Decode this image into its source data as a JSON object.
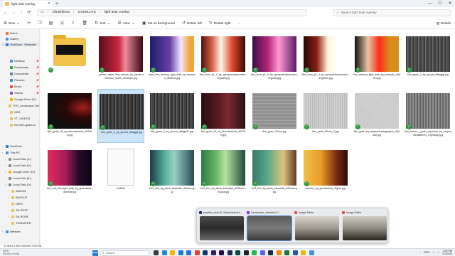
{
  "window": {
    "tab_title": "light leak overlay",
    "controls": [
      "—",
      "☐",
      "✕"
    ]
  },
  "address": {
    "crumbs": [
      "AfterEffects",
      "OVERLAYS",
      "light leak overlay"
    ],
    "search_placeholder": "Search light leak overlay"
  },
  "toolbar": {
    "new": "New",
    "sort": "Sort",
    "view": "View",
    "set_background": "Set as background",
    "rotate_left": "Rotate left",
    "rotate_right": "Rotate right",
    "more": "...",
    "details": "Details"
  },
  "sidebar": {
    "items": [
      {
        "label": "Home",
        "color": "#e07b39"
      },
      {
        "label": "Gallery",
        "color": "#3a8ee6"
      },
      {
        "label": "OneDrive - Personal",
        "color": "#2a7bd5"
      },
      {
        "label": "Desktop",
        "color": "#4a90d9"
      },
      {
        "label": "Downloads",
        "color": "#2e9a43"
      },
      {
        "label": "Documents",
        "color": "#6b7b8c"
      },
      {
        "label": "Pictures",
        "color": "#3b82c4"
      },
      {
        "label": "Music",
        "color": "#d9534f"
      },
      {
        "label": "Videos",
        "color": "#8e44ad"
      },
      {
        "label": "Google Drive (G:)",
        "color": "#f4b400"
      },
      {
        "label": "TOS_Landscape_full",
        "color": "#e9c25a"
      },
      {
        "label": "OBS",
        "color": "#e9c25a"
      },
      {
        "label": "YT_VIDEOS",
        "color": "#e9c25a"
      },
      {
        "label": "free-film-grain-ov",
        "color": "#e9c25a"
      },
      {
        "label": "OneDrive",
        "color": "#2a7bd5"
      },
      {
        "label": "This PC",
        "color": "#4a90d9"
      },
      {
        "label": "Local Disk (C:)",
        "color": "#7f8c8d"
      },
      {
        "label": "Local Disk (D:)",
        "color": "#7f8c8d"
      },
      {
        "label": "Google Drive (G:)",
        "color": "#f4b400"
      },
      {
        "label": "Local Disk (E:)",
        "color": "#7f8c8d"
      },
      {
        "label": "Local Disk (D:)",
        "color": "#7f8c8d"
      },
      {
        "label": "ADDON",
        "color": "#e9c25a"
      },
      {
        "label": "BACKUP",
        "color": "#e9c25a"
      },
      {
        "label": "DeFit",
        "color": "#e9c25a"
      },
      {
        "label": "SA-PDSF",
        "color": "#e9c25a"
      },
      {
        "label": "SA-RODE",
        "color": "#e9c25a"
      },
      {
        "label": "TRANSFER",
        "color": "#e9c25a"
      },
      {
        "label": "Network",
        "color": "#4a90d9"
      }
    ]
  },
  "files": [
    {
      "name": "",
      "kind": "folder"
    },
    {
      "name": "_amber_dawn_film_texture_by_miroeli-anderson_stock_d20wrlpe.jpg",
      "bg": "linear-gradient(90deg,#5a0d1c,#c8273d 45%,#f08a9a 60%,#3a0a12)"
    },
    {
      "name": "blue_film_camera_light_leak_by_tonicsdc_d4d3rc2.jpg",
      "bg": "linear-gradient(90deg,#1b1f6b,#6a3ea8 45%,#f3e6ff 70%,#f2a43b 90%)"
    },
    {
      "name": "film_burn_p1_3_by_apropostockwonder_d7jpd6d.jpg",
      "bg": "linear-gradient(90deg,#4b1010,#d9624a 25%,#fff6e8 45%,#e04a2e 70%,#3a0b0b)"
    },
    {
      "name": "film_burn_p1_4_by_apropostockwonder_d7jpd6d.jpg",
      "bg": "linear-gradient(90deg,#3a0d4a,#b3257a 35%,#ff9ad0 60%,#5a1a6b)"
    },
    {
      "name": "film_burn_p1_4_by_apropostockwonder_d7jpd2m.jpg",
      "bg": "linear-gradient(90deg,#2a0806,#8a1e12 30%,#fff4d8 55%,#ffffff 75%)"
    },
    {
      "name": "film_camera_light_leak_by_tonicsdc_d4d3rn.jpg",
      "bg": "linear-gradient(90deg,#0f0f0f,#e8c7a4 30%,#ff2d1a 55%,#d88e1a 80%)"
    },
    {
      "name": "film_grain_2_by_yuccai_d6wgjgf.jpg",
      "bg": "repeating-linear-gradient(90deg,#3c3c3c 0 2px,#6f6f6f 2px 3px,#4e4e4e 3px 5px)"
    },
    {
      "name": "film_grain_03_by_iibrucitestock_d2578m.jpg",
      "bg": "radial-gradient(ellipse at 80% 40%,#a4201a 0,#2a0806 35%,#0f0f0f 70%)"
    },
    {
      "name": "film_grain_3_by_yuccai_d6wgjgf.jpg",
      "bg": "repeating-linear-gradient(90deg,#2a2a2a 0 2px,#5e5e5e 2px 3px,#3e3e3e 3px 5px)",
      "selected": true
    },
    {
      "name": "film_grain_3_by_yuccai_d6wgh02.jpg",
      "bg": "repeating-linear-gradient(90deg,#303030 0 2px,#6b6b6b 2px 3px,#474747 3px 5px)"
    },
    {
      "name": "film_grain_01_by_iibrucitestock_d2578m.jpg",
      "bg": "linear-gradient(90deg,#2a0f12,#5a1a22 40%,#7a2a30 60%,#2a0f12)"
    },
    {
      "name": "film_grain_16mm.jpg",
      "bg": "repeating-linear-gradient(0deg,#8a8a8a 0 1px,#a3a3a3 1px 2px)"
    },
    {
      "name": "film_grain_16mm_2.jpg",
      "bg": "repeating-linear-gradient(90deg,#b8b8b8 0 1px,#cfcfcf 1px 3px)"
    },
    {
      "name": "film_grain_by_stephenbartsgraphic_d7jcb62.jpg",
      "bg": "repeating-linear-gradient(45deg,#c0c0c0 0 1px,#dadada 1px 2px)"
    },
    {
      "name": "film_texture__grain_exposure_by_stephanieplattenev_d7g9wwp.jpg",
      "bg": "repeating-linear-gradient(90deg,#5e5e5e 0 1px,#8e8e8e 1px 3px,#6e6e6e 3px 4px)"
    },
    {
      "name": "free_red_film_light_leak_by_greensleaf_d4ne3b.jpg",
      "bg": "linear-gradient(90deg,#e22a5a,#a61e58 40%,#2a0b2a 70%,#0b0412)"
    },
    {
      "name": "Untitled",
      "kind": "document"
    },
    {
      "name": "vol3_film_by_stock_bascettic_d29wun.jpg",
      "bg": "linear-gradient(90deg,#1b3a4a,#5ab3a0 35%,#9ad0c4 55%,#2a4a5a)"
    },
    {
      "name": "vol3_film_by_stock_bascettic_d29wven - Kopya.jpg",
      "bg": "linear-gradient(90deg,#2e7a4a,#6ab86a 35%,#b7e3a1 55%,#1f4a3a)"
    },
    {
      "name": "vol3_film_by_stock_bascettic_d29wven.jpg",
      "bg": "linear-gradient(90deg,#3a7a6a,#58a88a 35%,#e1c27a 70%,#5a3a2a)"
    },
    {
      "name": "autumn_by_pencilstock_d7jpxh.jpg",
      "bg": "linear-gradient(90deg,#f2c14a,#e89a28 40%,#7a2a12 75%,#2a0b06)"
    }
  ],
  "status": {
    "text": "22 items   1 item selected  3.05 MB"
  },
  "popup": {
    "previews": [
      {
        "title": "practice_test (C:\\Users\\Admin\\...",
        "icon_color": "#2a2a5a",
        "bg": "linear-gradient(180deg,#4a4a4a,#2a2a2a 50%,#6a6a6a)"
      },
      {
        "title": "Landscape_tutorial (C:\\...",
        "icon_color": "#8a2be2",
        "bg": "linear-gradient(180deg,#5a5a5a,#7a7a7a 50%,#3a3a3a)",
        "selected": true
      },
      {
        "title": "Image Editor",
        "icon_color": "#d9534f",
        "bg": "linear-gradient(180deg,#d9d4cc,#a09a90 50%,#3a3630)"
      },
      {
        "title": "Image Editor",
        "icon_color": "#d9534f",
        "bg": "linear-gradient(180deg,#d0cbc2,#8e8a80 50%,#2a2620)"
      }
    ]
  },
  "taskbar": {
    "weather_temp": "14°C",
    "weather_desc": "Mostly cloudy",
    "search_placeholder": "Search",
    "apps": [
      {
        "name": "task-view",
        "color": "#3a3a3a"
      },
      {
        "name": "widgets",
        "color": "#1f8ad4"
      },
      {
        "name": "file-explorer",
        "color": "#f2b705"
      },
      {
        "name": "edge",
        "color": "#0f7dd8"
      },
      {
        "name": "store",
        "color": "#2a6fd6"
      },
      {
        "name": "chrome",
        "color": "#db4437"
      },
      {
        "name": "photoshop",
        "color": "#0b3a6b"
      },
      {
        "name": "after-effects",
        "color": "#3b1c6b"
      },
      {
        "name": "premiere",
        "color": "#2a0b4a"
      },
      {
        "name": "media-encoder",
        "color": "#1f2a5a"
      },
      {
        "name": "audition",
        "color": "#0a4a3a"
      },
      {
        "name": "obs",
        "color": "#222222"
      },
      {
        "name": "spotify",
        "color": "#1db954"
      },
      {
        "name": "discord",
        "color": "#5865f2"
      },
      {
        "name": "steam",
        "color": "#1b2838"
      },
      {
        "name": "vlc",
        "color": "#f08a00"
      },
      {
        "name": "excel",
        "color": "#1e7145"
      },
      {
        "name": "word",
        "color": "#2b5797"
      },
      {
        "name": "explorer-active",
        "color": "#f2b705"
      },
      {
        "name": "notepad",
        "color": "#4a90d9"
      }
    ],
    "lang": "ENG",
    "time": "3:52 PM",
    "date": "1/1/2024"
  }
}
